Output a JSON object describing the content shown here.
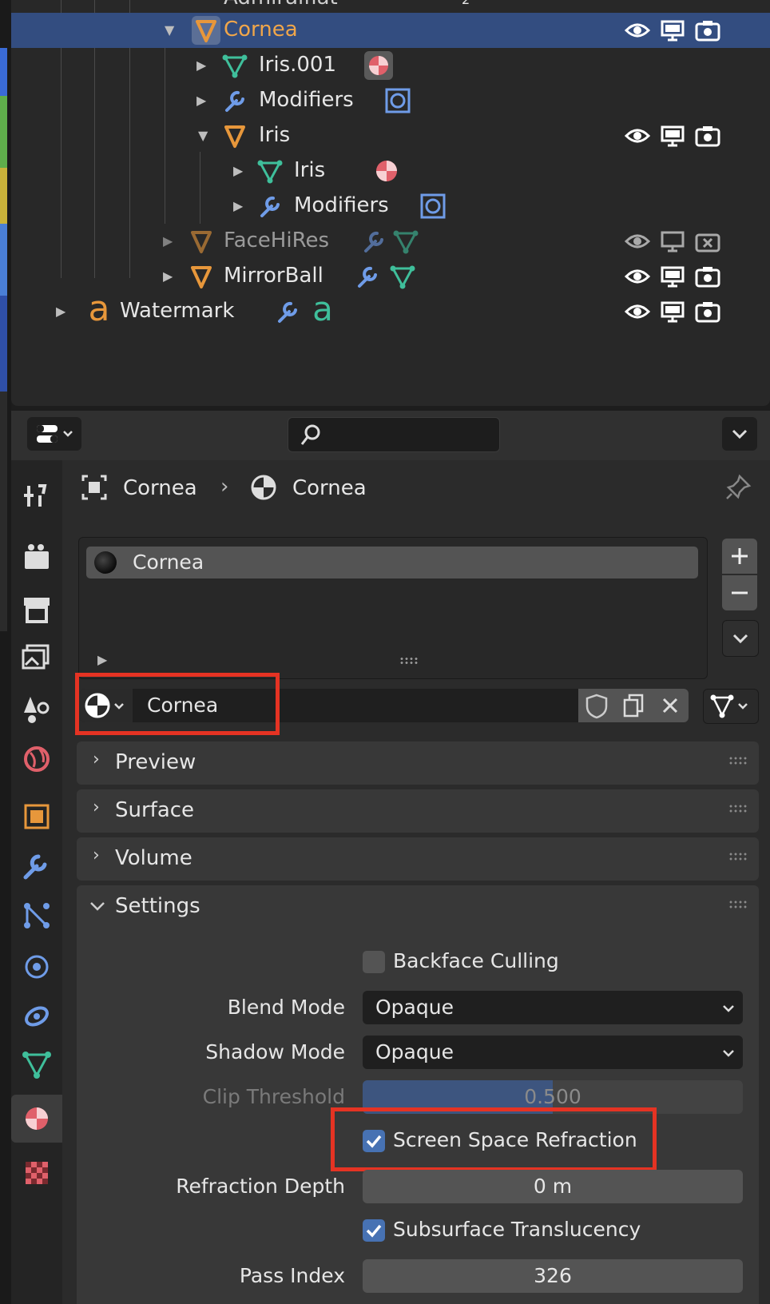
{
  "outliner": {
    "rows": [
      {
        "label": "Cornea",
        "selected": true
      },
      {
        "label": "Iris.001"
      },
      {
        "label": "Modifiers"
      },
      {
        "label": "Iris"
      },
      {
        "label": "Iris"
      },
      {
        "label": "Modifiers"
      },
      {
        "label": "FaceHiRes",
        "dimmed": true
      },
      {
        "label": "MirrorBall"
      },
      {
        "label": "Watermark"
      }
    ],
    "clipped_top_label": "Admiralflat",
    "clipped_count": "2"
  },
  "header": {
    "search_placeholder": ""
  },
  "breadcrumb": {
    "object": "Cornea",
    "material": "Cornea"
  },
  "material_slots": [
    {
      "name": "Cornea"
    }
  ],
  "material_datablock": {
    "name": "Cornea"
  },
  "panels": {
    "preview": "Preview",
    "surface": "Surface",
    "volume": "Volume",
    "settings": "Settings"
  },
  "settings": {
    "backface_culling": {
      "label": "Backface Culling",
      "checked": false
    },
    "blend_mode": {
      "label": "Blend Mode",
      "value": "Opaque"
    },
    "shadow_mode": {
      "label": "Shadow Mode",
      "value": "Opaque"
    },
    "clip_threshold": {
      "label": "Clip Threshold",
      "value": "0.500",
      "fraction": 0.5
    },
    "screen_space_refraction": {
      "label": "Screen Space Refraction",
      "checked": true
    },
    "refraction_depth": {
      "label": "Refraction Depth",
      "value": "0 m"
    },
    "subsurface_translucency": {
      "label": "Subsurface Translucency",
      "checked": true
    },
    "pass_index": {
      "label": "Pass Index",
      "value": "326"
    }
  },
  "colors": {
    "selection": "#334d80",
    "accent_check": "#4772b3",
    "highlight_box": "#e53323",
    "object_orange": "#e7973b",
    "mesh_green": "#3fbf9b",
    "modifier_blue": "#6f9ce8",
    "material_red": "#e0606a"
  }
}
